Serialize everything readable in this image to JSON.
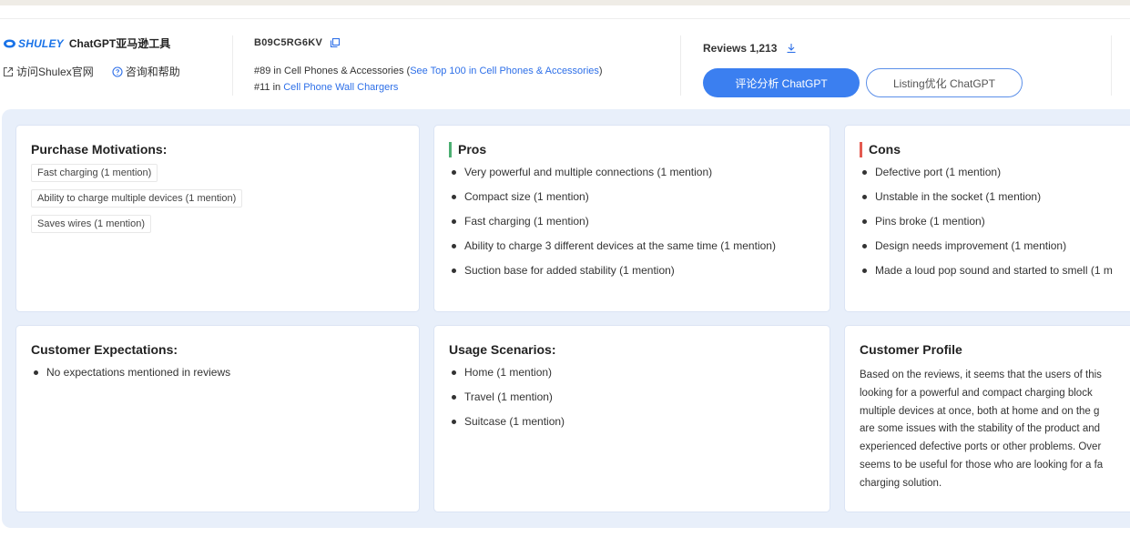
{
  "header": {
    "brand_logo": "SHULEY",
    "tool_name": "ChatGPT亚马逊工具",
    "link_official": "访问Shulex官网",
    "link_help": "咨询和帮助",
    "asin": "B09C5RG6KV",
    "rank1_prefix": "#89 in Cell Phones & Accessories (",
    "rank1_link": "See Top 100 in Cell Phones & Accessories",
    "rank1_suffix": ")",
    "rank2_prefix": "#11 in ",
    "rank2_link": "Cell Phone Wall Chargers",
    "reviews_label": "Reviews 1,213",
    "btn_review_analysis": "评论分析 ChatGPT",
    "btn_listing": "Listing优化 ChatGPT"
  },
  "purchase_motivations": {
    "title": "Purchase Motivations:",
    "items": [
      "Fast charging (1 mention)",
      "Ability to charge multiple devices (1 mention)",
      "Saves wires (1 mention)"
    ]
  },
  "pros": {
    "title": "Pros",
    "items": [
      "Very powerful and multiple connections (1 mention)",
      "Compact size (1 mention)",
      "Fast charging (1 mention)",
      "Ability to charge 3 different devices at the same time (1 mention)",
      "Suction base for added stability (1 mention)"
    ]
  },
  "cons": {
    "title": "Cons",
    "items": [
      "Defective port (1 mention)",
      "Unstable in the socket (1 mention)",
      "Pins broke (1 mention)",
      "Design needs improvement (1 mention)",
      "Made a loud pop sound and started to smell (1 m"
    ]
  },
  "customer_expectations": {
    "title": "Customer Expectations:",
    "items": [
      "No expectations mentioned in reviews"
    ]
  },
  "usage_scenarios": {
    "title": "Usage Scenarios:",
    "items": [
      "Home (1 mention)",
      "Travel (1 mention)",
      "Suitcase (1 mention)"
    ]
  },
  "customer_profile": {
    "title": "Customer Profile",
    "lines": [
      "Based on the reviews, it seems that the users of this",
      "looking for a powerful and compact charging block",
      "multiple devices at once, both at home and on the g",
      "are some issues with the stability of the product and",
      "experienced defective ports or other problems. Over",
      "seems to be useful for those who are looking for a fa",
      "charging solution."
    ]
  },
  "colors": {
    "accent_blue": "#3b7ff0",
    "link_blue": "#2d6fe8",
    "pros_bar": "#4caf72",
    "cons_bar": "#e45a50",
    "panel_bg": "#e8effa"
  },
  "icons": [
    "shulex-logo-icon",
    "external-link-icon",
    "help-circle-icon",
    "copy-icon",
    "download-icon"
  ]
}
